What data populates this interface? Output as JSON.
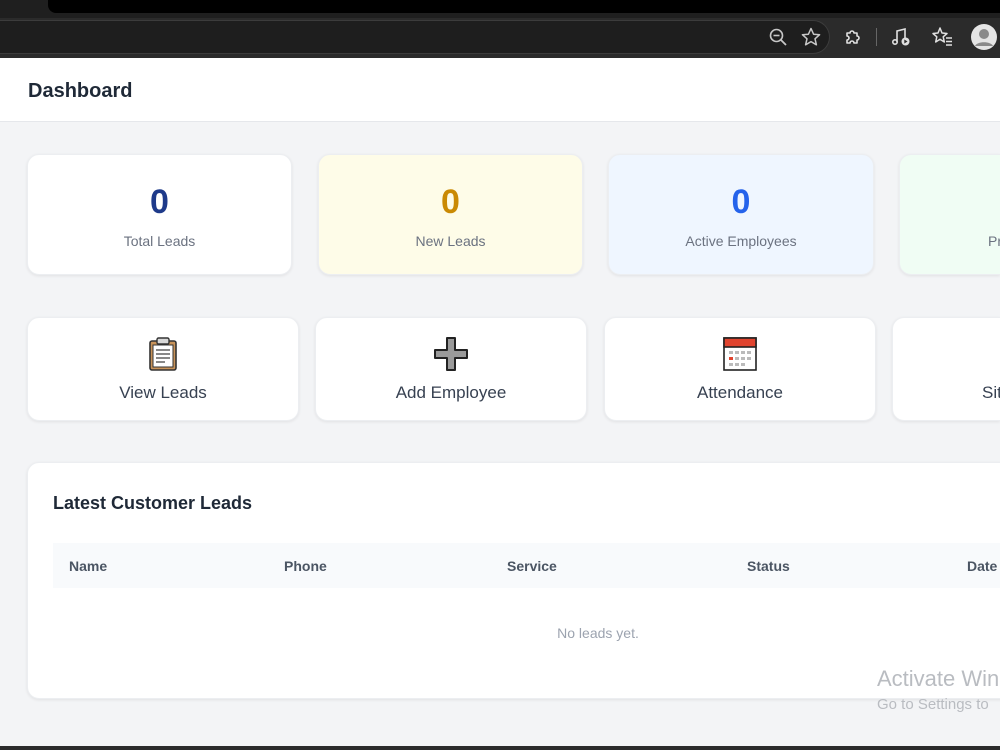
{
  "browser": {
    "icons": [
      "zoom-out-icon",
      "bookmark-star-icon",
      "extensions-icon",
      "media-controls-icon",
      "favorites-icon",
      "profile-avatar-icon"
    ]
  },
  "header": {
    "title": "Dashboard"
  },
  "stats": [
    {
      "value": "0",
      "label": "Total Leads",
      "value_color": "#1e3a8a",
      "bg": "#ffffff"
    },
    {
      "value": "0",
      "label": "New Leads",
      "value_color": "#ca8a04",
      "bg": "#fefce8"
    },
    {
      "value": "0",
      "label": "Active Employees",
      "value_color": "#2563eb",
      "bg": "#eff6ff"
    },
    {
      "value": "",
      "label": "Pr",
      "value_color": "#16a34a",
      "bg": "#f0fdf4"
    }
  ],
  "actions": [
    {
      "label": "View Leads",
      "icon": "clipboard-icon"
    },
    {
      "label": "Add Employee",
      "icon": "plus-icon"
    },
    {
      "label": "Attendance",
      "icon": "calendar-icon"
    },
    {
      "label": "Sit",
      "icon": ""
    }
  ],
  "leads": {
    "title": "Latest Customer Leads",
    "columns": [
      "Name",
      "Phone",
      "Service",
      "Status",
      "Date"
    ],
    "empty_text": "No leads yet."
  },
  "watermark": {
    "title": "Activate Win",
    "subtitle": "Go to Settings to"
  }
}
